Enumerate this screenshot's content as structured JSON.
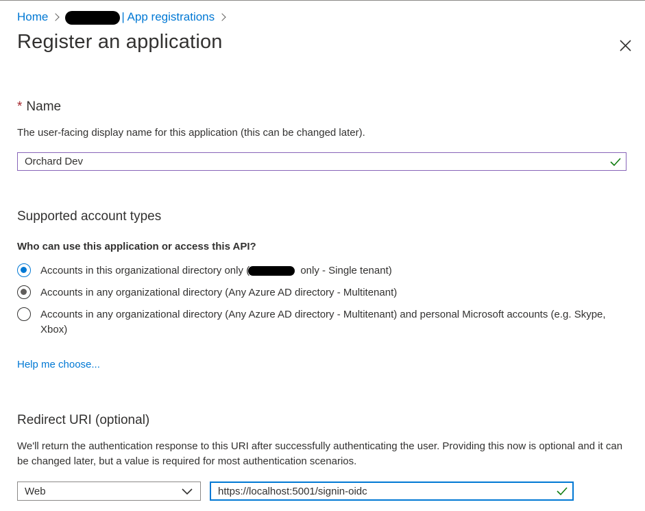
{
  "breadcrumb": {
    "home": "Home",
    "app_registrations": "| App registrations"
  },
  "title": "Register an application",
  "name_section": {
    "required_marker": "*",
    "heading": "Name",
    "description": "The user-facing display name for this application (this can be changed later).",
    "value": "Orchard Dev"
  },
  "account_types": {
    "heading": "Supported account types",
    "question": "Who can use this application or access this API?",
    "options": [
      {
        "label_before": "Accounts in this organizational directory only (",
        "label_after": " only - Single tenant)",
        "state": "selected"
      },
      {
        "label": "Accounts in any organizational directory (Any Azure AD directory - Multitenant)",
        "state": "hover"
      },
      {
        "label": "Accounts in any organizational directory (Any Azure AD directory - Multitenant) and personal Microsoft accounts (e.g. Skype, Xbox)",
        "state": "unselected"
      }
    ],
    "help_link": "Help me choose..."
  },
  "redirect": {
    "heading": "Redirect URI (optional)",
    "description": "We'll return the authentication response to this URI after successfully authenticating the user. Providing this now is optional and it can be changed later, but a value is required for most authentication scenarios.",
    "platform": "Web",
    "uri": "https://localhost:5001/signin-oidc"
  },
  "icons": {
    "close": "close-icon",
    "check": "checkmark-icon",
    "chevron": "chevron-down-icon"
  },
  "colors": {
    "accent": "#0078d4",
    "valid_check": "#107c10",
    "required": "#a4262c"
  }
}
